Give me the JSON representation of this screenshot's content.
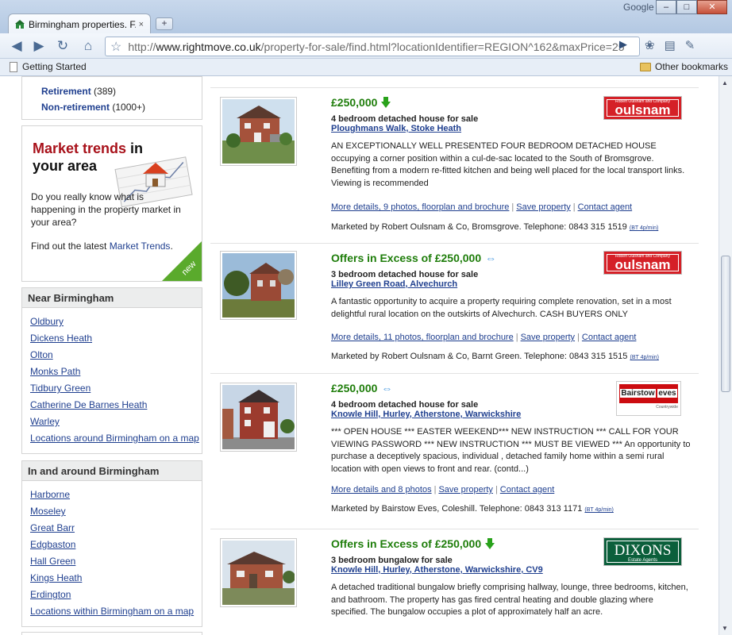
{
  "browser": {
    "tab_title": "Birmingham properties. F...",
    "tab_close": "×",
    "new_tab": "+",
    "brand": "Google",
    "url_prefix": "http://",
    "url_domain": "www.rightmove.co.uk",
    "url_path": "/property-for-sale/find.html?locationIdentifier=REGION^162&maxPrice=25",
    "bookmarks": {
      "getting_started": "Getting Started",
      "other": "Other bookmarks"
    },
    "window_buttons": {
      "minimize": "–",
      "maximize": "□",
      "close": "✕"
    }
  },
  "sidebar": {
    "retirement": [
      {
        "label": "Retirement",
        "count": "(389)"
      },
      {
        "label": "Non-retirement",
        "count": "(1000+)"
      }
    ],
    "market_trends": {
      "title_red": "Market trends",
      "title_rest": " in your area",
      "body": "Do you really know what is happening in the property market in your area?",
      "find_prefix": "Find out the latest ",
      "find_link": "Market Trends",
      "find_suffix": ".",
      "badge": "new"
    },
    "near": {
      "heading": "Near Birmingham",
      "items": [
        "Oldbury",
        "Dickens Heath",
        "Olton",
        "Monks Path",
        "Tidbury Green",
        "Catherine De Barnes Heath",
        "Warley",
        "Locations around Birmingham on a map"
      ]
    },
    "around": {
      "heading": "In and around Birmingham",
      "items": [
        "Harborne",
        "Moseley",
        "Great Barr",
        "Edgbaston",
        "Hall Green",
        "Kings Heath",
        "Erdington",
        "Locations within Birmingham on a map"
      ]
    }
  },
  "listings": [
    {
      "price": "£250,000",
      "price_indicator": "reduced-down-arrow",
      "type": "4 bedroom detached house for sale",
      "address": "Ploughmans Walk, Stoke Heath",
      "description": "AN EXCEPTIONALLY WELL PRESENTED FOUR BEDROOM DETACHED HOUSE occupying a corner position within a cul-de-sac located to the South of Bromsgrove. Benefiting from a modern re-fitted kitchen and being well placed for the local transport links. Viewing is recommended",
      "details": "More details, 9 photos, floorplan and brochure",
      "save": "Save property",
      "contact": "Contact agent",
      "marketed": "Marketed by Robert Oulsnam & Co, Bromsgrove. Telephone: 0843 315 1519",
      "rate": "(BT 4p/min)",
      "agent": "oulsnam"
    },
    {
      "price": "Offers in Excess of £250,000",
      "price_indicator": "unchanged-arrows",
      "type": "3 bedroom detached house for sale",
      "address": "Lilley Green Road, Alvechurch",
      "description": "A fantastic opportunity to acquire a property requiring complete renovation, set in a most delightful rural location on the outskirts of Alvechurch. CASH BUYERS ONLY",
      "details": "More details, 11 photos, floorplan and brochure",
      "save": "Save property",
      "contact": "Contact agent",
      "marketed": "Marketed by Robert Oulsnam & Co, Barnt Green. Telephone: 0843 315 1515",
      "rate": "(BT 4p/min)",
      "agent": "oulsnam"
    },
    {
      "price": "£250,000",
      "price_indicator": "unchanged-arrows",
      "type": "4 bedroom detached house for sale",
      "address": "Knowle Hill, Hurley, Atherstone, Warwickshire",
      "description": "*** OPEN HOUSE *** EASTER WEEKEND*** NEW INSTRUCTION *** CALL FOR YOUR VIEWING PASSWORD *** NEW INSTRUCTION *** MUST BE VIEWED *** An opportunity to purchase a deceptively spacious, individual , detached family home within a semi rural location with open views to front and rear. (contd...)",
      "details": "More details and 8 photos",
      "save": "Save property",
      "contact": "Contact agent",
      "marketed": "Marketed by Bairstow Eves, Coleshill. Telephone: 0843 313 1171",
      "rate": "(BT 4p/min)",
      "agent": "bairstow"
    },
    {
      "price": "Offers in Excess of £250,000",
      "price_indicator": "reduced-down-arrow",
      "type": "3 bedroom bungalow for sale",
      "address": "Knowle Hill, Hurley, Atherstone, Warwickshire, CV9",
      "description": "A detached traditional bungalow briefly comprising hallway, lounge, three bedrooms, kitchen, and bathroom. The property has gas fired central heating and double glazing where specified. The bungalow occupies a plot of approximately half an acre.",
      "agent": "dixons"
    }
  ],
  "agents": {
    "oulsnam": {
      "name": "oulsnam",
      "tagline": "Robert Oulsnam and Company"
    },
    "bairstow": {
      "name_a": "Bairstow",
      "name_b": "eves",
      "tagline": "Countrywide"
    },
    "dixons": {
      "name": "DIXONS",
      "tagline": "Estate Agents"
    }
  },
  "colors": {
    "price_green": "#1e7d0a",
    "link_blue": "#1f3f8f",
    "oulsnam_red": "#d52027",
    "dixons_green": "#0b5f3b"
  }
}
